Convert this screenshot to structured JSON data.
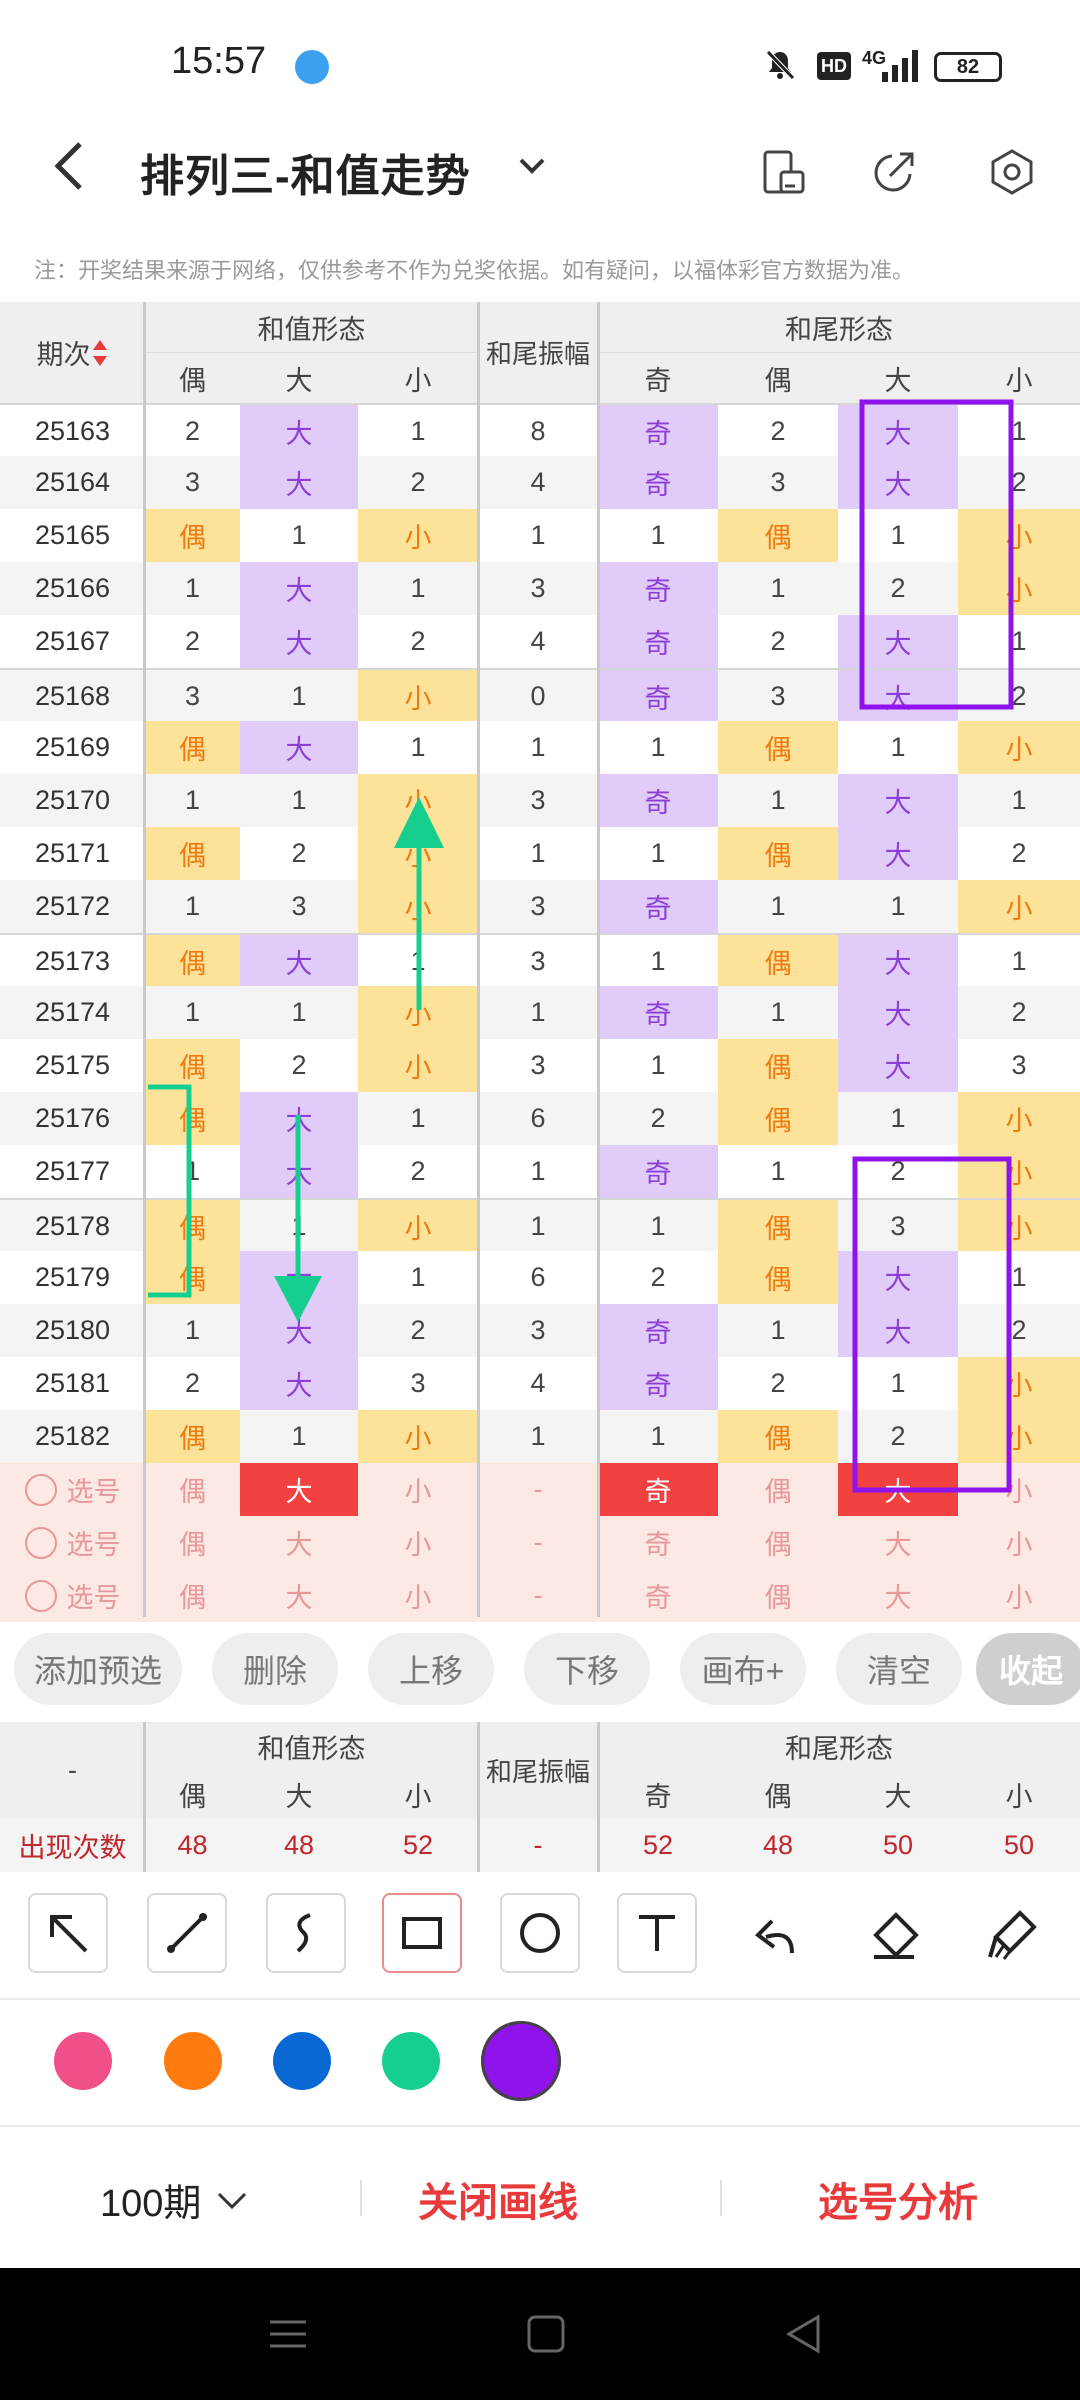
{
  "status": {
    "time": "15:57",
    "battery": "82",
    "network": "4G",
    "hd": "HD"
  },
  "header": {
    "title": "排列三-和值走势"
  },
  "notice": "注：开奖结果来源于网络，仅供参考不作为兑奖依据。如有疑问，以福体彩官方数据为准。",
  "table": {
    "period_header": "期次",
    "sum_form_header": "和值形态",
    "amp_header": "和尾振幅",
    "tail_form_header": "和尾形态",
    "cols": [
      "偶",
      "大",
      "小",
      "奇",
      "偶",
      "大",
      "小"
    ],
    "rows": [
      {
        "p": "25163",
        "c": [
          "2",
          "大",
          "1",
          "8",
          "奇",
          "2",
          "大",
          "1"
        ]
      },
      {
        "p": "25164",
        "c": [
          "3",
          "大",
          "2",
          "4",
          "奇",
          "3",
          "大",
          "2"
        ]
      },
      {
        "p": "25165",
        "c": [
          "偶",
          "1",
          "小",
          "1",
          "1",
          "偶",
          "1",
          "小"
        ]
      },
      {
        "p": "25166",
        "c": [
          "1",
          "大",
          "1",
          "3",
          "奇",
          "1",
          "2",
          "小"
        ]
      },
      {
        "p": "25167",
        "c": [
          "2",
          "大",
          "2",
          "4",
          "奇",
          "2",
          "大",
          "1"
        ]
      },
      {
        "p": "25168",
        "c": [
          "3",
          "1",
          "小",
          "0",
          "奇",
          "3",
          "大",
          "2"
        ]
      },
      {
        "p": "25169",
        "c": [
          "偶",
          "大",
          "1",
          "1",
          "1",
          "偶",
          "1",
          "小"
        ]
      },
      {
        "p": "25170",
        "c": [
          "1",
          "1",
          "小",
          "3",
          "奇",
          "1",
          "大",
          "1"
        ]
      },
      {
        "p": "25171",
        "c": [
          "偶",
          "2",
          "小",
          "1",
          "1",
          "偶",
          "大",
          "2"
        ]
      },
      {
        "p": "25172",
        "c": [
          "1",
          "3",
          "小",
          "3",
          "奇",
          "1",
          "1",
          "小"
        ]
      },
      {
        "p": "25173",
        "c": [
          "偶",
          "大",
          "1",
          "3",
          "1",
          "偶",
          "大",
          "1"
        ]
      },
      {
        "p": "25174",
        "c": [
          "1",
          "1",
          "小",
          "1",
          "奇",
          "1",
          "大",
          "2"
        ]
      },
      {
        "p": "25175",
        "c": [
          "偶",
          "2",
          "小",
          "3",
          "1",
          "偶",
          "大",
          "3"
        ]
      },
      {
        "p": "25176",
        "c": [
          "偶",
          "大",
          "1",
          "6",
          "2",
          "偶",
          "1",
          "小"
        ]
      },
      {
        "p": "25177",
        "c": [
          "1",
          "大",
          "2",
          "1",
          "奇",
          "1",
          "2",
          "小"
        ]
      },
      {
        "p": "25178",
        "c": [
          "偶",
          "1",
          "小",
          "1",
          "1",
          "偶",
          "3",
          "小"
        ]
      },
      {
        "p": "25179",
        "c": [
          "偶",
          "大",
          "1",
          "6",
          "2",
          "偶",
          "大",
          "1"
        ]
      },
      {
        "p": "25180",
        "c": [
          "1",
          "大",
          "2",
          "3",
          "奇",
          "1",
          "大",
          "2"
        ]
      },
      {
        "p": "25181",
        "c": [
          "2",
          "大",
          "3",
          "4",
          "奇",
          "2",
          "1",
          "小"
        ]
      },
      {
        "p": "25182",
        "c": [
          "偶",
          "1",
          "小",
          "1",
          "1",
          "偶",
          "2",
          "小"
        ]
      }
    ],
    "pick_rows": [
      {
        "label": "选号",
        "c": [
          "偶",
          "大",
          "小",
          "-",
          "奇",
          "偶",
          "大",
          "小"
        ]
      },
      {
        "label": "选号",
        "c": [
          "偶",
          "大",
          "小",
          "-",
          "奇",
          "偶",
          "大",
          "小"
        ]
      },
      {
        "label": "选号",
        "c": [
          "偶",
          "大",
          "小",
          "-",
          "奇",
          "偶",
          "大",
          "小"
        ]
      }
    ]
  },
  "buttons": [
    "添加预选",
    "删除",
    "上移",
    "下移",
    "画布+",
    "清空",
    "收起"
  ],
  "stats": {
    "row_header": "-",
    "label": "出现次数",
    "values": [
      "48",
      "48",
      "52",
      "-",
      "52",
      "48",
      "50",
      "50"
    ]
  },
  "tools": [
    "arrow-tool-icon",
    "line-tool-icon",
    "curve-tool-icon",
    "rect-tool-icon",
    "circle-tool-icon",
    "text-tool-icon",
    "undo-icon",
    "eraser-icon",
    "clear-brush-icon"
  ],
  "colors": [
    "#f0508a",
    "#ff7a0f",
    "#0a68d2",
    "#16cf8f",
    "#8f14ec"
  ],
  "bottom": {
    "period": "100期",
    "close_draw": "关闭画线",
    "analysis": "选号分析"
  },
  "accent": "#e83a3a"
}
